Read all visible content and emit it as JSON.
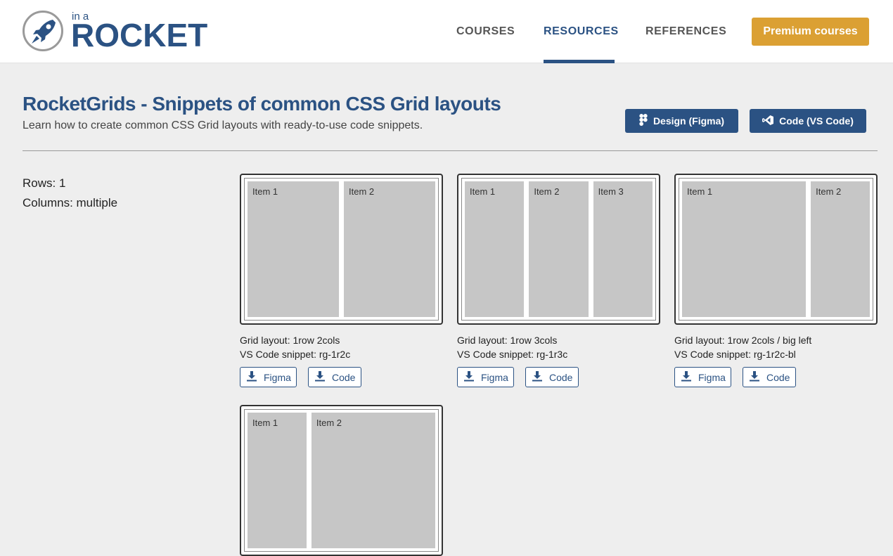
{
  "logo": {
    "small": "in a",
    "big": "ROCKET"
  },
  "nav": {
    "courses": "COURSES",
    "resources": "RESOURCES",
    "references": "REFERENCES"
  },
  "premium_label": "Premium courses",
  "page": {
    "title": "RocketGrids - Snippets of common CSS Grid layouts",
    "subtitle": "Learn how to create common CSS Grid layouts with ready-to-use code snippets.",
    "design_button": "Design (Figma)",
    "code_button": "Code (VS Code)"
  },
  "filters": {
    "rows": "Rows: 1",
    "columns": "Columns: multiple"
  },
  "cards": [
    {
      "title": "Grid layout: 1row 2cols",
      "snippet": "VS Code snippet: rg-1r2c",
      "items": [
        "Item 1",
        "Item 2"
      ],
      "figma": "Figma",
      "code": "Code"
    },
    {
      "title": "Grid layout: 1row 3cols",
      "snippet": "VS Code snippet: rg-1r3c",
      "items": [
        "Item 1",
        "Item 2",
        "Item 3"
      ],
      "figma": "Figma",
      "code": "Code"
    },
    {
      "title": "Grid layout: 1row 2cols / big left",
      "snippet": "VS Code snippet: rg-1r2c-bl",
      "items": [
        "Item 1",
        "Item 2"
      ],
      "figma": "Figma",
      "code": "Code"
    },
    {
      "items": [
        "Item 1",
        "Item 2"
      ]
    }
  ],
  "colors": {
    "brand": "#2b5283",
    "accent": "#dba033",
    "item": "#c6c6c6",
    "background": "#eeeeee"
  },
  "icons": {
    "logo": "rocket-icon",
    "design": "figma-icon",
    "code": "vscode-icon",
    "download": "download-icon"
  }
}
